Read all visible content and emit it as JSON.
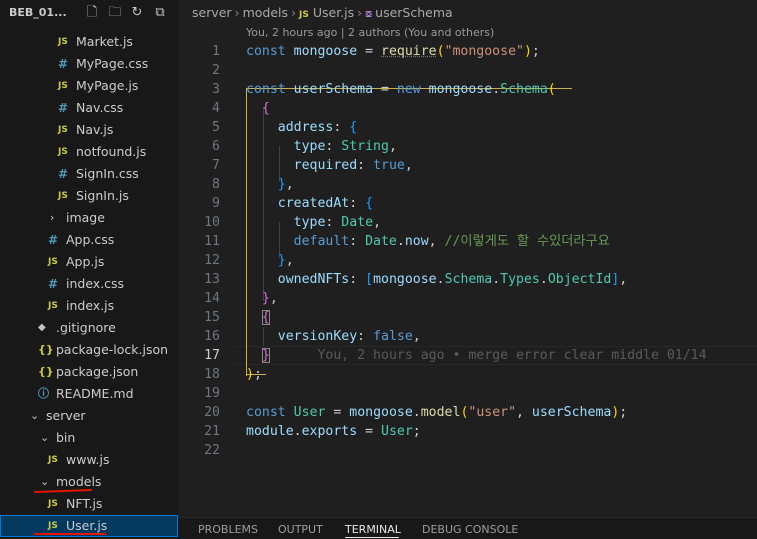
{
  "sidebar": {
    "title": "BEB_01...",
    "actions": [
      "new-file-icon",
      "new-folder-icon",
      "refresh-icon",
      "collapse-all-icon"
    ],
    "items": [
      {
        "label": "Market.js",
        "type": "js",
        "indent": 2
      },
      {
        "label": "MyPage.css",
        "type": "css",
        "indent": 2
      },
      {
        "label": "MyPage.js",
        "type": "js",
        "indent": 2
      },
      {
        "label": "Nav.css",
        "type": "css",
        "indent": 2
      },
      {
        "label": "Nav.js",
        "type": "js",
        "indent": 2
      },
      {
        "label": "notfound.js",
        "type": "js",
        "indent": 2
      },
      {
        "label": "SignIn.css",
        "type": "css",
        "indent": 2
      },
      {
        "label": "SignIn.js",
        "type": "js",
        "indent": 2
      },
      {
        "label": "image",
        "type": "folder-closed",
        "indent": 1
      },
      {
        "label": "App.css",
        "type": "css",
        "indent": 1
      },
      {
        "label": "App.js",
        "type": "js",
        "indent": 1
      },
      {
        "label": "index.css",
        "type": "css",
        "indent": 1
      },
      {
        "label": "index.js",
        "type": "js",
        "indent": 1
      },
      {
        "label": ".gitignore",
        "type": "git",
        "indent": 0
      },
      {
        "label": "package-lock.json",
        "type": "json",
        "indent": 0
      },
      {
        "label": "package.json",
        "type": "json",
        "indent": 0
      },
      {
        "label": "README.md",
        "type": "info",
        "indent": 0
      },
      {
        "label": "server",
        "type": "folder-open",
        "indent": -1
      },
      {
        "label": "bin",
        "type": "folder-open",
        "indent": 0
      },
      {
        "label": "www.js",
        "type": "js",
        "indent": 1
      },
      {
        "label": "models",
        "type": "folder-open",
        "indent": 0
      },
      {
        "label": "NFT.js",
        "type": "js",
        "indent": 1
      },
      {
        "label": "User.js",
        "type": "js",
        "indent": 1,
        "selected": true
      }
    ]
  },
  "breadcrumb": {
    "parts": [
      "server",
      "models",
      "User.js",
      "userSchema"
    ]
  },
  "codelens": "You, 2 hours ago | 2 authors (You and others)",
  "code": {
    "active_line": 17,
    "lines": [
      {
        "n": "1"
      },
      {
        "n": "2"
      },
      {
        "n": "3"
      },
      {
        "n": "4"
      },
      {
        "n": "5"
      },
      {
        "n": "6"
      },
      {
        "n": "7"
      },
      {
        "n": "8"
      },
      {
        "n": "9"
      },
      {
        "n": "10"
      },
      {
        "n": "11"
      },
      {
        "n": "12"
      },
      {
        "n": "13"
      },
      {
        "n": "14"
      },
      {
        "n": "15"
      },
      {
        "n": "16"
      },
      {
        "n": "17"
      },
      {
        "n": "18"
      },
      {
        "n": "19"
      },
      {
        "n": "20"
      },
      {
        "n": "21"
      },
      {
        "n": "22"
      }
    ],
    "text": {
      "l1_kw": "const",
      "l1_var": "mongoose",
      "l1_op": " = ",
      "l1_fn": "require",
      "l1_str": "\"mongoose\"",
      "l1_end": ");",
      "l3_kw": "const",
      "l3_var": "userSchema",
      "l3_op": " = ",
      "l3_new": "new",
      "l3_obj": "mongoose",
      "l3_cls": "Schema",
      "address": "address",
      "type": "type",
      "String": "String",
      "required": "required",
      "true": "true",
      "createdAt": "createdAt",
      "Date": "Date",
      "default": "default",
      "Date2": "Date",
      "now": "now",
      "comment": "//이렇게도 할 수있더라구요",
      "ownedNFTs": "ownedNFTs",
      "mongoose2": "mongoose",
      "Schema2": "Schema",
      "Types": "Types",
      "ObjectId": "ObjectId",
      "versionKey": "versionKey",
      "false": "false",
      "blame": "You, 2 hours ago • merge error clear middle 01/14",
      "l20_kw": "const",
      "l20_cls": "User",
      "l20_obj": "mongoose",
      "l20_fn": "model",
      "l20_str": "\"user\"",
      "l20_var": "userSchema",
      "l21_obj": "module",
      "l21_prop": "exports",
      "l21_cls": "User"
    }
  },
  "panel": {
    "tabs": [
      "PROBLEMS",
      "OUTPUT",
      "TERMINAL",
      "DEBUG CONSOLE"
    ],
    "active": "TERMINAL"
  }
}
